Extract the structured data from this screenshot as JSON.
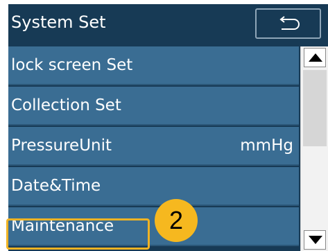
{
  "header": {
    "title": "System Set",
    "back_icon": "return-arrow-icon"
  },
  "menu": {
    "items": [
      {
        "label": "lock screen Set",
        "value": ""
      },
      {
        "label": "Collection Set",
        "value": ""
      },
      {
        "label": "PressureUnit",
        "value": "mmHg"
      },
      {
        "label": "Date&Time",
        "value": ""
      },
      {
        "label": "Maintenance",
        "value": ""
      }
    ]
  },
  "scrollbar": {
    "up_icon": "scroll-up-arrow-icon",
    "down_icon": "scroll-down-arrow-icon"
  },
  "annotation": {
    "step": "2",
    "color": "#f6b81f"
  },
  "colors": {
    "header_bg": "#173a55",
    "row_bg": "#3a6d93",
    "text": "#ffffff"
  }
}
